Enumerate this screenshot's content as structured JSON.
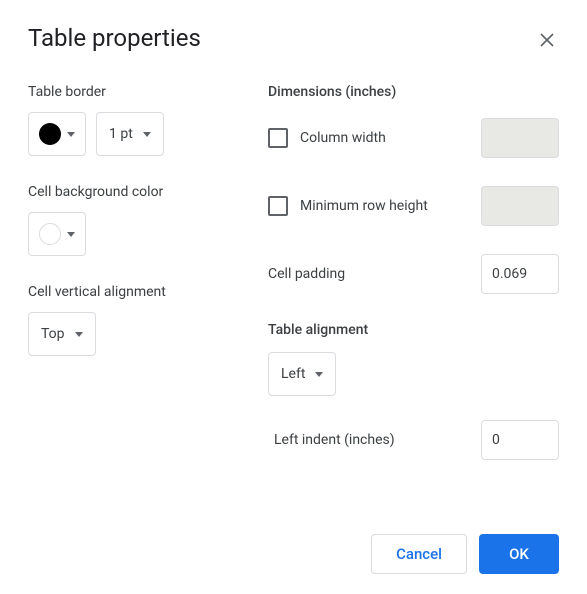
{
  "dialog": {
    "title": "Table properties"
  },
  "left": {
    "border_label": "Table border",
    "border_width": "1 pt",
    "bg_label": "Cell background color",
    "valign_label": "Cell vertical alignment",
    "valign_value": "Top"
  },
  "right": {
    "dimensions_label": "Dimensions  (inches)",
    "col_width_label": "Column width",
    "min_row_label": "Minimum row height",
    "cell_padding_label": "Cell padding",
    "cell_padding_value": "0.069",
    "table_align_label": "Table alignment",
    "table_align_value": "Left",
    "left_indent_label": "Left indent  (inches)",
    "left_indent_value": "0"
  },
  "footer": {
    "cancel": "Cancel",
    "ok": "OK"
  }
}
